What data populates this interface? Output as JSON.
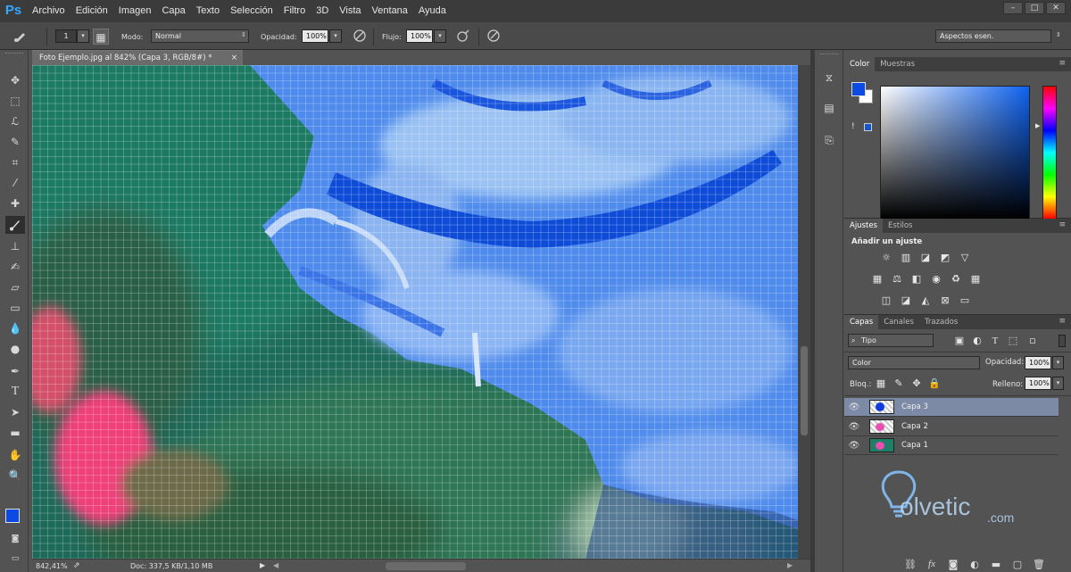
{
  "app": {
    "logo": "Ps"
  },
  "menu": [
    "Archivo",
    "Edición",
    "Imagen",
    "Capa",
    "Texto",
    "Selección",
    "Filtro",
    "3D",
    "Vista",
    "Ventana",
    "Ayuda"
  ],
  "window_buttons": {
    "minimize": "–",
    "maximize": "□",
    "close": "✕"
  },
  "options": {
    "brush_size": "1",
    "mode_label": "Modo:",
    "mode_value": "Normal",
    "opacity_label": "Opacidad:",
    "opacity_value": "100%",
    "flow_label": "Flujo:",
    "flow_value": "100%",
    "workspace_value": "Aspectos esen."
  },
  "document": {
    "tab_title": "Foto Ejemplo.jpg al 842% (Capa 3, RGB/8#) *",
    "tab_close": "×",
    "zoom": "842,41%",
    "doc_size": "Doc: 337,5 KB/1,10 MB"
  },
  "color_panel": {
    "tabs": [
      "Color",
      "Muestras"
    ],
    "foreground": "#0b4be3",
    "background": "#ffffff",
    "warning": "!"
  },
  "adjust_panel": {
    "tabs": [
      "Ajustes",
      "Estilos"
    ],
    "heading": "Añadir un ajuste",
    "row1": [
      "brightness-icon",
      "levels-icon",
      "curves-icon",
      "exposure-icon",
      "vibrance-icon"
    ],
    "row2": [
      "hue-icon",
      "color-balance-icon",
      "bw-icon",
      "photo-filter-icon",
      "channel-mixer-icon",
      "color-lookup-icon"
    ],
    "row3": [
      "invert-icon",
      "posterize-icon",
      "threshold-icon",
      "selective-color-icon",
      "gradient-map-icon"
    ]
  },
  "layers_panel": {
    "tabs": [
      "Capas",
      "Canales",
      "Trazados"
    ],
    "filter_value": "Tipo",
    "blend_value": "Color",
    "opacity_label": "Opacidad:",
    "opacity_value": "100%",
    "lock_label": "Bloq.:",
    "fill_label": "Relleno:",
    "fill_value": "100%",
    "layers": [
      {
        "name": "Capa 3",
        "selected": true
      },
      {
        "name": "Capa 2",
        "selected": false
      },
      {
        "name": "Capa 1",
        "selected": false
      }
    ]
  },
  "watermark": {
    "text": "olvetic",
    "suffix": ".com"
  }
}
